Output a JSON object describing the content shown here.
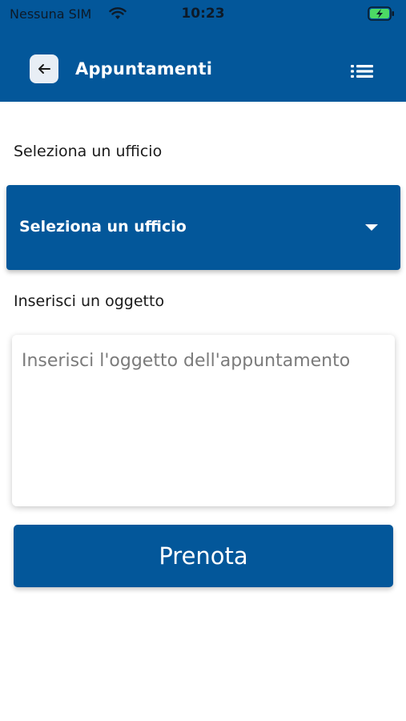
{
  "status_bar": {
    "carrier": "Nessuna SIM",
    "time": "10:23",
    "wifi_icon": "wifi-icon",
    "battery_icon": "battery-charging-icon"
  },
  "header": {
    "title": "Appuntamenti",
    "back_icon": "arrow-left-icon",
    "menu_icon": "list-icon",
    "background": "#03579a"
  },
  "form": {
    "office_label": "Seleziona un ufficio",
    "office_select_value": "Seleziona un ufficio",
    "subject_label": "Inserisci un oggetto",
    "subject_placeholder": "Inserisci l'oggetto dell'appuntamento",
    "subject_value": "",
    "submit_label": "Prenota"
  },
  "colors": {
    "primary": "#03579a",
    "back_button_bg": "#e8eef5"
  }
}
